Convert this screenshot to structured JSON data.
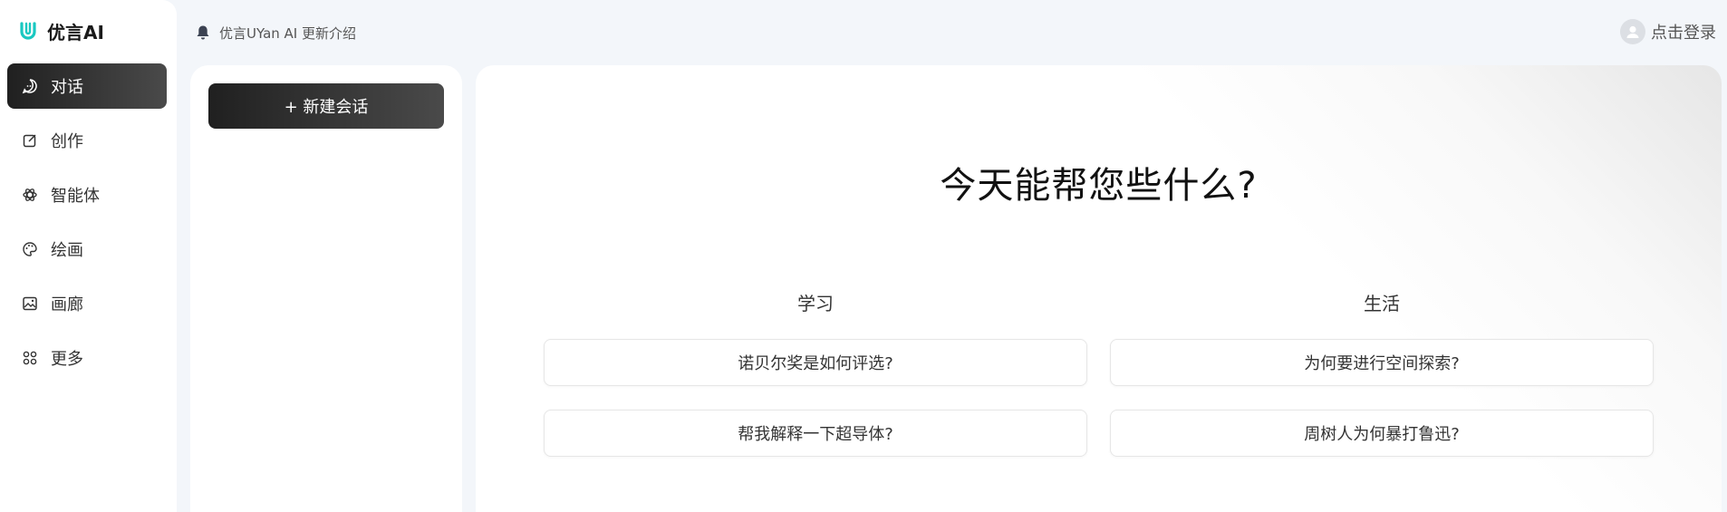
{
  "brand": {
    "name": "优言AI",
    "accent": "#19c8c1"
  },
  "nav": {
    "items": [
      {
        "label": "对话",
        "icon": "chat-icon",
        "active": true
      },
      {
        "label": "创作",
        "icon": "edit-icon",
        "active": false
      },
      {
        "label": "智能体",
        "icon": "agent-icon",
        "active": false
      },
      {
        "label": "绘画",
        "icon": "palette-icon",
        "active": false
      },
      {
        "label": "画廊",
        "icon": "gallery-icon",
        "active": false
      },
      {
        "label": "更多",
        "icon": "more-icon",
        "active": false
      }
    ]
  },
  "topbar": {
    "notice": "优言UYan AI 更新介绍",
    "login_label": "点击登录"
  },
  "history": {
    "new_chat_label": "+ 新建会话"
  },
  "main": {
    "headline": "今天能帮您些什么?",
    "columns": [
      {
        "title": "学习",
        "suggestions": [
          "诺贝尔奖是如何评选?",
          "帮我解释一下超导体?"
        ]
      },
      {
        "title": "生活",
        "suggestions": [
          "为何要进行空间探索?",
          "周树人为何暴打鲁迅?"
        ]
      }
    ]
  }
}
